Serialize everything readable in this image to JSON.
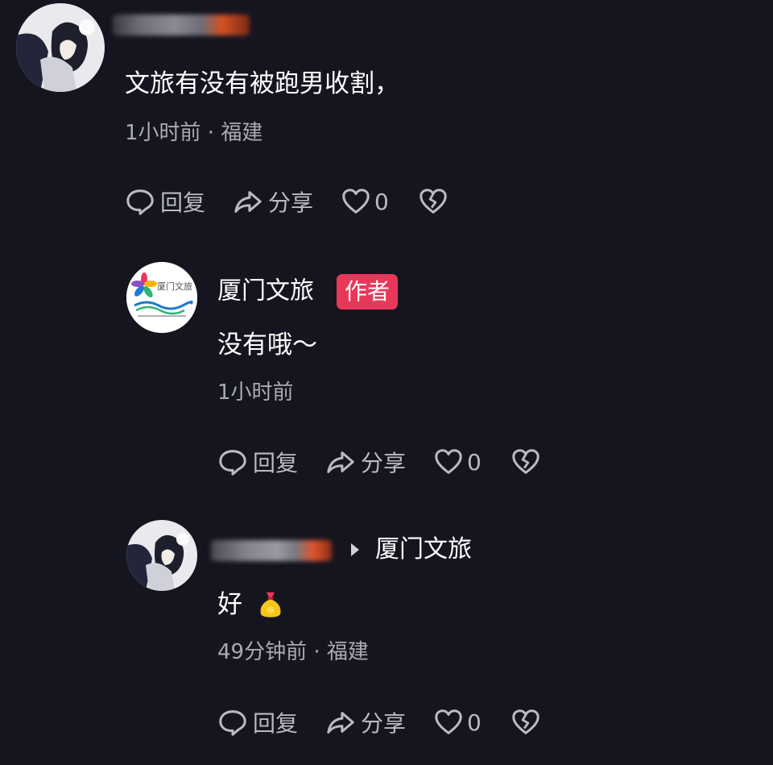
{
  "comments": [
    {
      "text": "文旅有没有被跑男收割，",
      "meta": "1小时前 · 福建",
      "actions": {
        "reply": "回复",
        "share": "分享",
        "likes": "0"
      }
    },
    {
      "author": "厦门文旅",
      "badge": "作者",
      "text": "没有哦～",
      "meta": "1小时前",
      "actions": {
        "reply": "回复",
        "share": "分享",
        "likes": "0"
      }
    },
    {
      "reply_to": "厦门文旅",
      "text": "好",
      "emoji": "money-bag-emoji",
      "meta": "49分钟前 · 福建",
      "actions": {
        "reply": "回复",
        "share": "分享",
        "likes": "0"
      }
    }
  ],
  "colors": {
    "background": "#151520",
    "badge": "#e8385a",
    "meta": "#a9aab3"
  },
  "icons": [
    "reply-icon",
    "share-icon",
    "like-icon",
    "dislike-icon"
  ]
}
